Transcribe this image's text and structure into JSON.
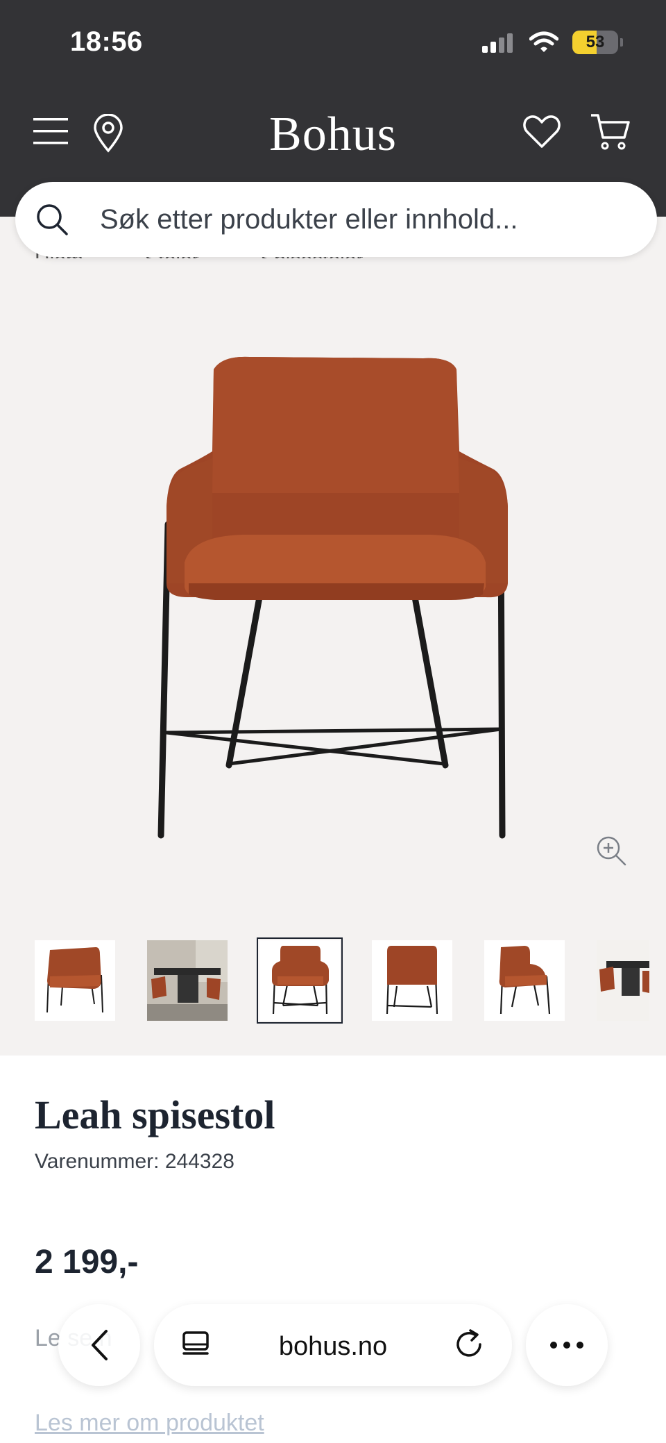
{
  "status_bar": {
    "time": "18:56",
    "battery_level": "53"
  },
  "header": {
    "logo": "Bohus"
  },
  "search": {
    "placeholder": "Søk etter produkter eller innhold..."
  },
  "breadcrumb": [
    "Hjem",
    "Stoler",
    "Spisestoler"
  ],
  "product": {
    "name": "Leah spisestol",
    "sku": "Varenummer: 244328",
    "price": "2 199,-",
    "description_peek": "Le                se                                                      n",
    "read_more": "Les mer om produktet"
  },
  "gallery": {
    "active_index": 2,
    "thumbnail_count": 6
  },
  "browser": {
    "url": "bohus.no"
  },
  "colors": {
    "header_bg": "#333336",
    "gallery_bg": "#f4f2f1",
    "chair": "#a64a28",
    "text": "#1d2430",
    "battery": "#f4d02f"
  }
}
